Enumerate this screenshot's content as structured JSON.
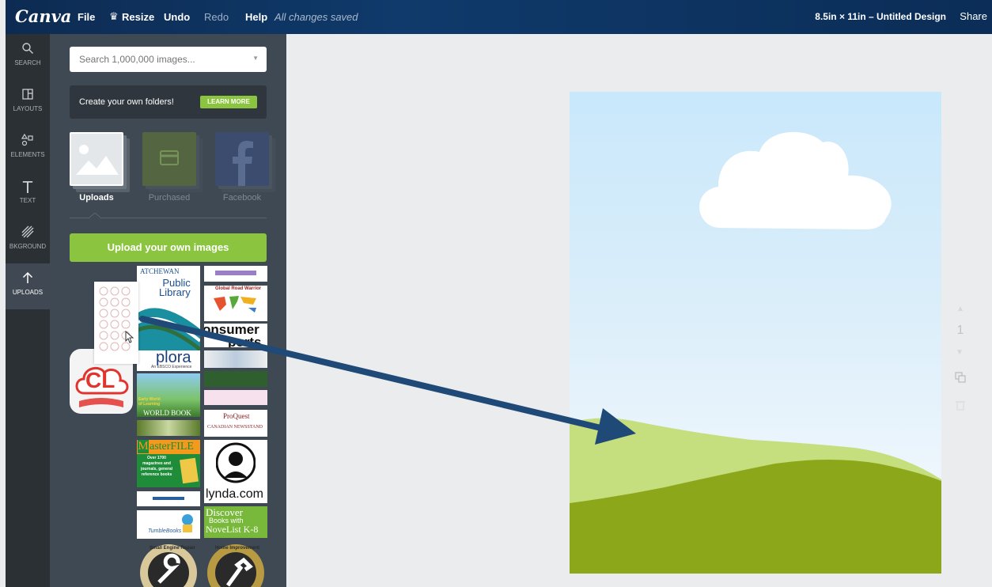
{
  "topbar": {
    "logo": "Canva",
    "menu": {
      "file": "File",
      "resize": "Resize",
      "undo": "Undo",
      "redo": "Redo",
      "help": "Help"
    },
    "save_status": "All changes saved",
    "doc_title": "8.5in × 11in – Untitled Design",
    "share": "Share"
  },
  "sidebar": {
    "items": [
      {
        "label": "SEARCH",
        "icon": "search-icon"
      },
      {
        "label": "LAYOUTS",
        "icon": "layouts-icon"
      },
      {
        "label": "ELEMENTS",
        "icon": "elements-icon"
      },
      {
        "label": "TEXT",
        "icon": "text-icon"
      },
      {
        "label": "BKGROUND",
        "icon": "background-icon"
      },
      {
        "label": "UPLOADS",
        "icon": "upload-icon"
      }
    ],
    "active": "UPLOADS"
  },
  "panel": {
    "search_placeholder": "Search 1,000,000 images...",
    "promo_text": "Create your own folders!",
    "promo_button": "LEARN MORE",
    "folders": [
      {
        "label": "Uploads",
        "selected": true
      },
      {
        "label": "Purchased",
        "selected": false
      },
      {
        "label": "Facebook",
        "selected": false
      }
    ],
    "upload_button": "Upload your own images",
    "thumbnails": {
      "cl": "CL",
      "public_library": "Public\nLibrary",
      "library_arc": "ATCHEWAN",
      "global_road": "Global Road Warrior",
      "consumer": "onsumer",
      "consumer2": "ports",
      "explora": "plora",
      "explora_sub": "An EBSCO Experience",
      "world_book": "WORLD BOOK",
      "early_world": "Early World of Learning",
      "proquest": "ProQuest",
      "canadian_newsstand": "CANADIAN NEWSSTAND",
      "masterfile": "asterFILE",
      "masterfile_m": "M",
      "masterfile_desc": "Over 1700 magazines and journals, general reference books",
      "lynda": "lynda.com",
      "discover": "Discover",
      "books_with": "Books with",
      "novelist": "NoveList K-8",
      "tumble": "TumbleBooks",
      "small_engine": "Small Engine Repair",
      "home_improvement": "Home Improvement"
    }
  },
  "canvas": {
    "page_number": "1"
  },
  "colors": {
    "topbar": "#0f3a6b",
    "accent_green": "#8bc53f",
    "panel": "#3f4954",
    "arrow": "#1f4a78",
    "grass_light": "#c5de7e",
    "grass_dark": "#8ca81a"
  }
}
